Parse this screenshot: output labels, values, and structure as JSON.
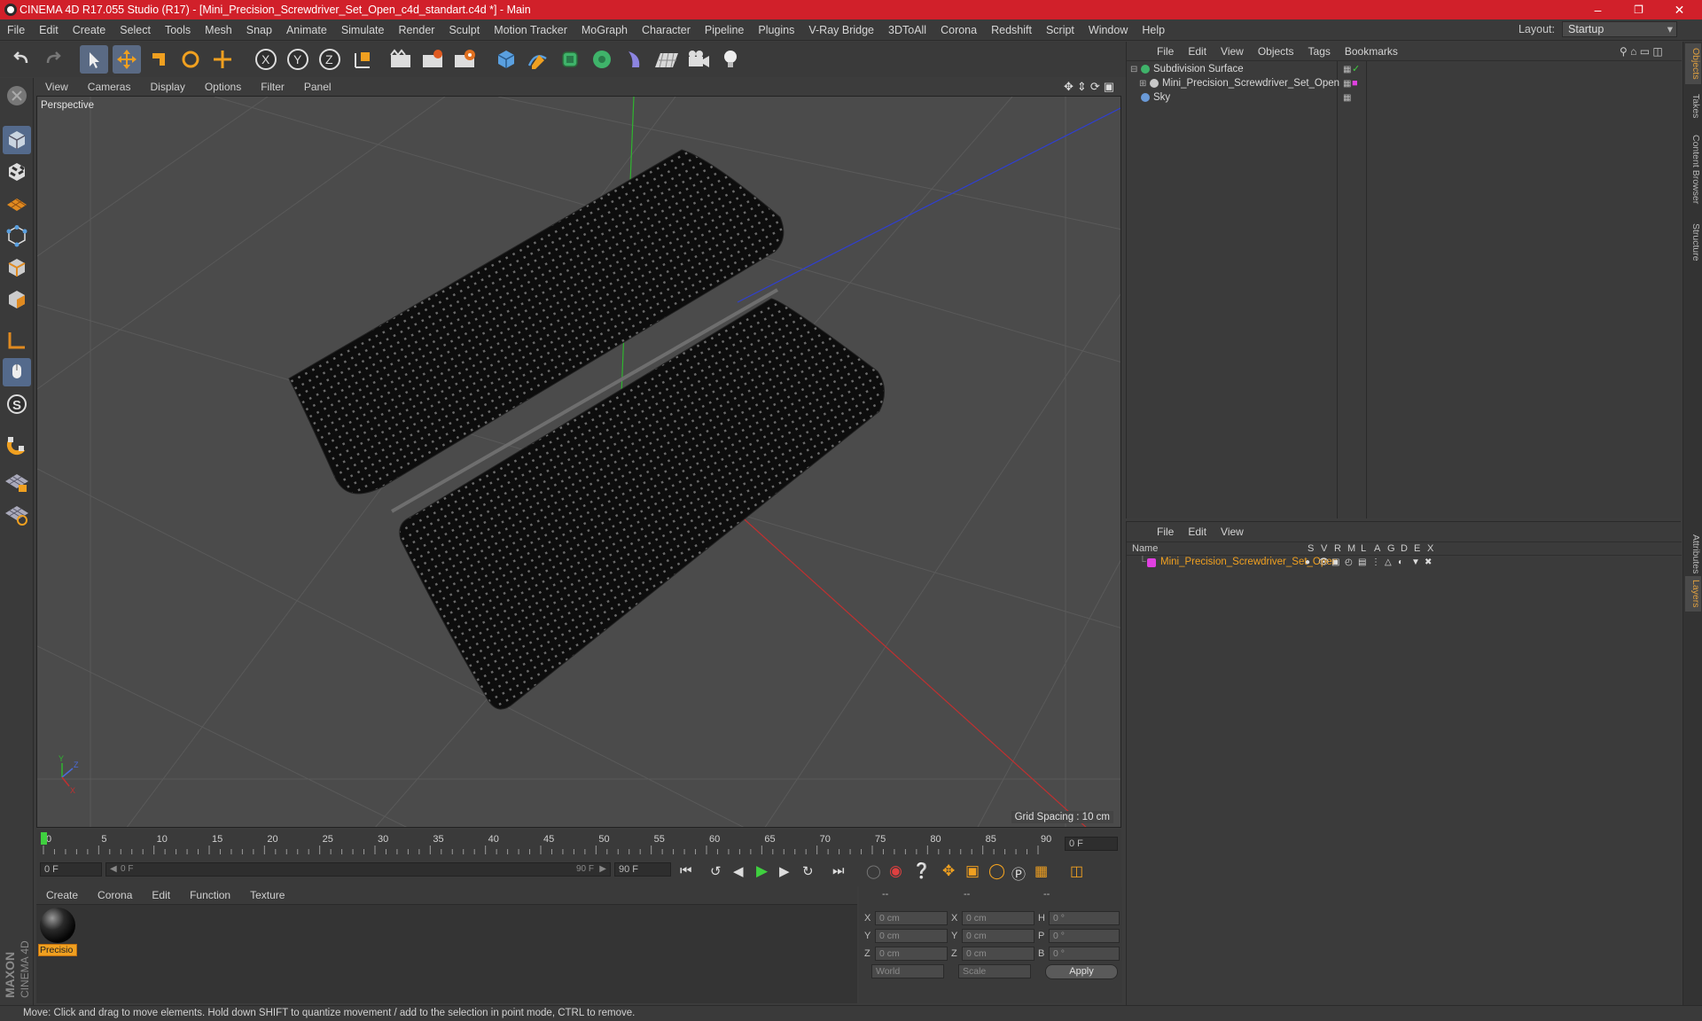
{
  "window": {
    "title": "CINEMA 4D R17.055 Studio (R17) - [Mini_Precision_Screwdriver_Set_Open_c4d_standart.c4d *] - Main"
  },
  "menu": [
    "File",
    "Edit",
    "Create",
    "Select",
    "Tools",
    "Mesh",
    "Snap",
    "Animate",
    "Simulate",
    "Render",
    "Sculpt",
    "Motion Tracker",
    "MoGraph",
    "Character",
    "Pipeline",
    "Plugins",
    "V-Ray Bridge",
    "3DToAll",
    "Corona",
    "Redshift",
    "Script",
    "Window",
    "Help"
  ],
  "layout": {
    "label": "Layout:",
    "value": "Startup"
  },
  "viewport_menu": [
    "View",
    "Cameras",
    "Display",
    "Options",
    "Filter",
    "Panel"
  ],
  "viewport": {
    "label": "Perspective",
    "grid_spacing": "Grid Spacing : 10 cm"
  },
  "timeline": {
    "ticks": [
      0,
      5,
      10,
      15,
      20,
      25,
      30,
      35,
      40,
      45,
      50,
      55,
      60,
      65,
      70,
      75,
      80,
      85,
      90
    ],
    "current_frame": "0 F",
    "start_frame": "0 F",
    "range_start": "0 F",
    "range_end": "90 F",
    "end_frame": "90 F",
    "playhead": 0,
    "max": 90
  },
  "material_menu": [
    "Create",
    "Corona",
    "Edit",
    "Function",
    "Texture"
  ],
  "materials": [
    {
      "name": "Precisio"
    }
  ],
  "coordinates": {
    "col1": "--",
    "col2": "--",
    "col3": "--",
    "rows": [
      {
        "a": "X",
        "av": "0 cm",
        "b": "X",
        "bv": "0 cm",
        "c": "H",
        "cv": "0 °"
      },
      {
        "a": "Y",
        "av": "0 cm",
        "b": "Y",
        "bv": "0 cm",
        "c": "P",
        "cv": "0 °"
      },
      {
        "a": "Z",
        "av": "0 cm",
        "b": "Z",
        "bv": "0 cm",
        "c": "B",
        "cv": "0 °"
      }
    ],
    "mode1": "World",
    "mode2": "Scale",
    "apply_label": "Apply"
  },
  "object_menu": [
    "File",
    "Edit",
    "View",
    "Objects",
    "Tags",
    "Bookmarks"
  ],
  "objects": [
    {
      "name": "Subdivision Surface",
      "icon": "subdivision-icon",
      "color": "#3fb36a",
      "indent": 0
    },
    {
      "name": "Mini_Precision_Screwdriver_Set_Open",
      "icon": "null-object-icon",
      "color": "#c8c8c8",
      "indent": 1
    },
    {
      "name": "Sky",
      "icon": "sky-icon",
      "color": "#6a9ad8",
      "indent": 0
    }
  ],
  "layer_menu": [
    "File",
    "Edit",
    "View"
  ],
  "layers": {
    "header_name": "Name",
    "columns": [
      "S",
      "V",
      "R",
      "M",
      "L",
      "A",
      "G",
      "D",
      "E",
      "X"
    ],
    "rows": [
      {
        "name": "Mini_Precision_Screwdriver_Set_Open",
        "color": "#e040e0"
      }
    ]
  },
  "side_tabs": [
    "Objects",
    "Takes",
    "Content Browser",
    "Structure",
    "Attributes",
    "Layers"
  ],
  "status": {
    "text": "Move: Click and drag to move elements. Hold down SHIFT to quantize movement / add to the selection in point mode, CTRL to remove."
  }
}
